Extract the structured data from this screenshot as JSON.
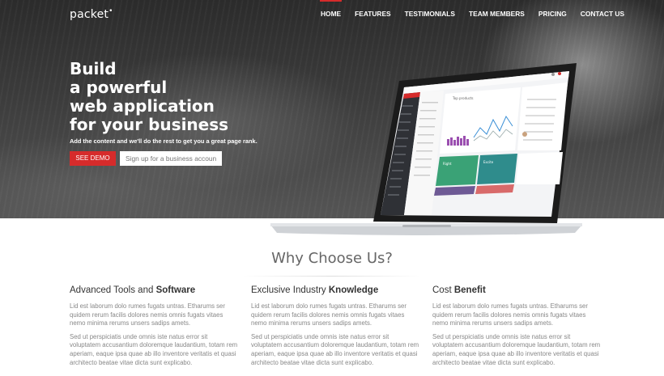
{
  "brand": {
    "logo": "packet",
    "logo_mark": "•"
  },
  "nav": {
    "items": [
      "HOME",
      "FEATURES",
      "TESTIMONIALS",
      "TEAM MEMBERS",
      "PRICING",
      "CONTACT US"
    ],
    "active": "HOME"
  },
  "hero": {
    "title_lines": [
      "Build",
      "a powerful",
      "web application",
      "for your business"
    ],
    "subtitle": "Add the content and we'll do the rest to get you a great page rank.",
    "demo_button": "SEE DEMO",
    "signup_placeholder": "Sign up for a business account"
  },
  "laptop_screen": {
    "chart_title": "Top products",
    "tile_left_label": "Right",
    "tile_right_label": "Excite"
  },
  "features": {
    "title": "Why Choose Us?",
    "columns": [
      {
        "title_plain": "Advanced Tools and ",
        "title_bold": "Software",
        "p1": "Lid est laborum dolo rumes fugats untras. Etharums ser quidem rerum facilis dolores nemis omnis fugats vitaes nemo minima rerums unsers sadips amets.",
        "p2": "Sed ut perspiciatis unde omnis iste natus error sit voluptatem accusantium doloremque laudantium, totam rem aperiam, eaque ipsa quae ab illo inventore veritatis et quasi architecto beatae vitae dicta sunt explicabo."
      },
      {
        "title_plain": "Exclusive Industry ",
        "title_bold": "Knowledge",
        "p1": "Lid est laborum dolo rumes fugats untras. Etharums ser quidem rerum facilis dolores nemis omnis fugats vitaes nemo minima rerums unsers sadips amets.",
        "p2": "Sed ut perspiciatis unde omnis iste natus error sit voluptatem accusantium doloremque laudantium, totam rem aperiam, eaque ipsa quae ab illo inventore veritatis et quasi architecto beatae vitae dicta sunt explicabo."
      },
      {
        "title_plain": "Cost ",
        "title_bold": "Benefit",
        "p1": "Lid est laborum dolo rumes fugats untras. Etharums ser quidem rerum facilis dolores nemis omnis fugats vitaes nemo minima rerums unsers sadips amets.",
        "p2": "Sed ut perspiciatis unde omnis iste natus error sit voluptatem accusantium doloremque laudantium, totam rem aperiam, eaque ipsa quae ab illo inventore veritatis et quasi architecto beatae vitae dicta sunt explicabo."
      }
    ]
  },
  "colors": {
    "accent": "#d62b2b",
    "hero_bg": "#3a3a3a",
    "text_muted": "#888888"
  }
}
